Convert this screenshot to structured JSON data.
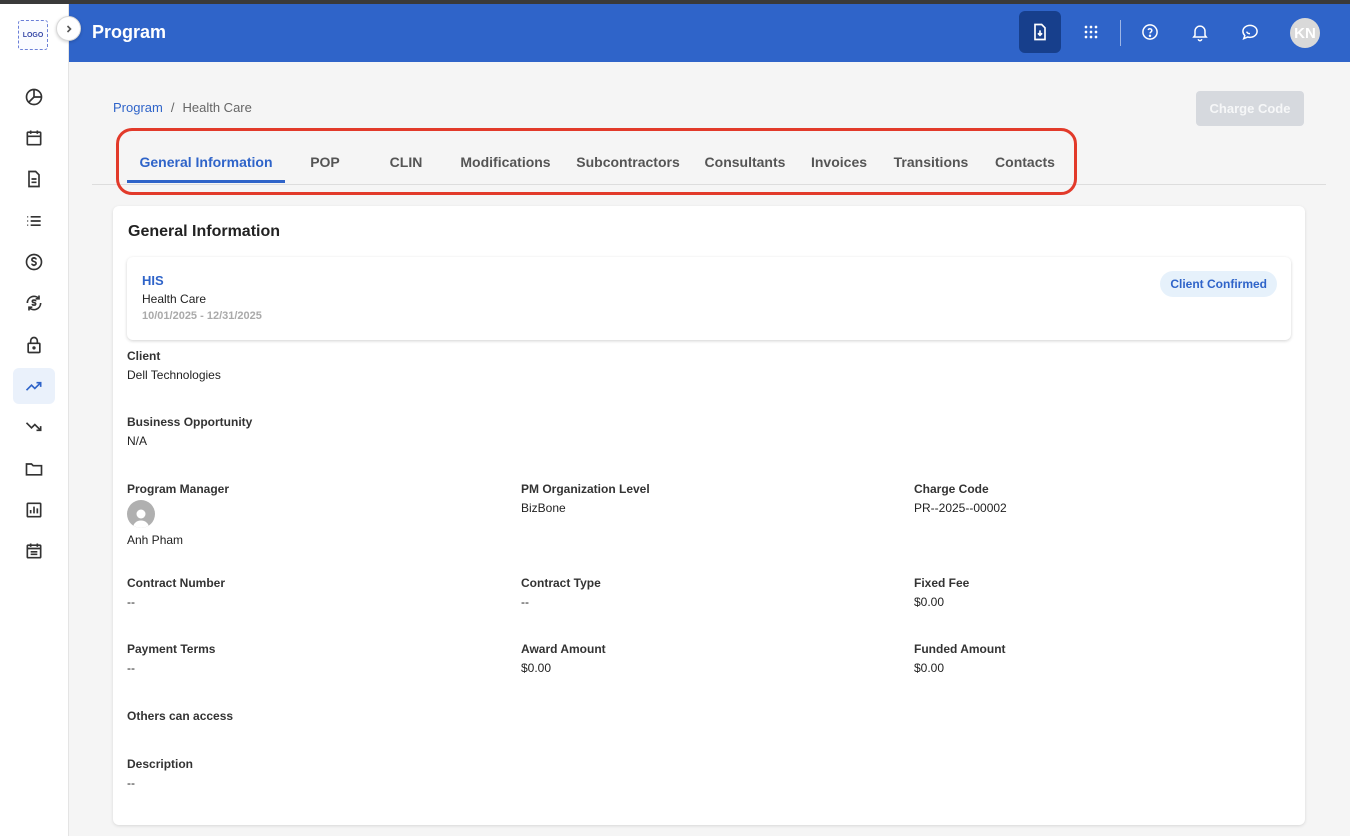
{
  "app": {
    "logo_text": "LOGO",
    "title": "Program",
    "user_initials": "KN"
  },
  "sidebar": {
    "items": [
      {
        "icon": "pie-chart-icon"
      },
      {
        "icon": "calendar-icon"
      },
      {
        "icon": "document-icon"
      },
      {
        "icon": "list-icon"
      },
      {
        "icon": "dollar-icon"
      },
      {
        "icon": "dollar-sync-icon"
      },
      {
        "icon": "lock-icon"
      },
      {
        "icon": "trending-up-icon",
        "active": true
      },
      {
        "icon": "trending-down-icon"
      },
      {
        "icon": "folder-icon"
      },
      {
        "icon": "bar-report-icon"
      },
      {
        "icon": "calendar-list-icon"
      }
    ]
  },
  "breadcrumb": {
    "root": "Program",
    "separator": "/",
    "current": "Health Care"
  },
  "actions": {
    "charge_code_button": "Charge Code"
  },
  "tabs": [
    {
      "label": "General Information",
      "active": true
    },
    {
      "label": "POP"
    },
    {
      "label": "CLIN"
    },
    {
      "label": "Modifications"
    },
    {
      "label": "Subcontractors"
    },
    {
      "label": "Consultants"
    },
    {
      "label": "Invoices"
    },
    {
      "label": "Transitions"
    },
    {
      "label": "Contacts"
    }
  ],
  "general": {
    "title": "General Information",
    "program": {
      "code": "HIS",
      "name": "Health Care",
      "dates": "10/01/2025 - 12/31/2025",
      "status": "Client Confirmed"
    },
    "client": {
      "label": "Client",
      "value": "Dell Technologies"
    },
    "business_opportunity": {
      "label": "Business Opportunity",
      "value": "N/A"
    },
    "program_manager": {
      "label": "Program Manager",
      "value": "Anh Pham"
    },
    "pm_org_level": {
      "label": "PM Organization Level",
      "value": "BizBone"
    },
    "charge_code": {
      "label": "Charge Code",
      "value": "PR--2025--00002"
    },
    "contract_number": {
      "label": "Contract Number",
      "value": "--"
    },
    "contract_type": {
      "label": "Contract Type",
      "value": "--"
    },
    "fixed_fee": {
      "label": "Fixed Fee",
      "value": "$0.00"
    },
    "payment_terms": {
      "label": "Payment Terms",
      "value": "--"
    },
    "award_amount": {
      "label": "Award Amount",
      "value": "$0.00"
    },
    "funded_amount": {
      "label": "Funded Amount",
      "value": "$0.00"
    },
    "others_access": {
      "label": "Others can access"
    },
    "description": {
      "label": "Description",
      "value": "--"
    }
  },
  "colors": {
    "header": "#2f64c9",
    "accent": "#2f64c9",
    "highlight": "#e23a2a"
  }
}
